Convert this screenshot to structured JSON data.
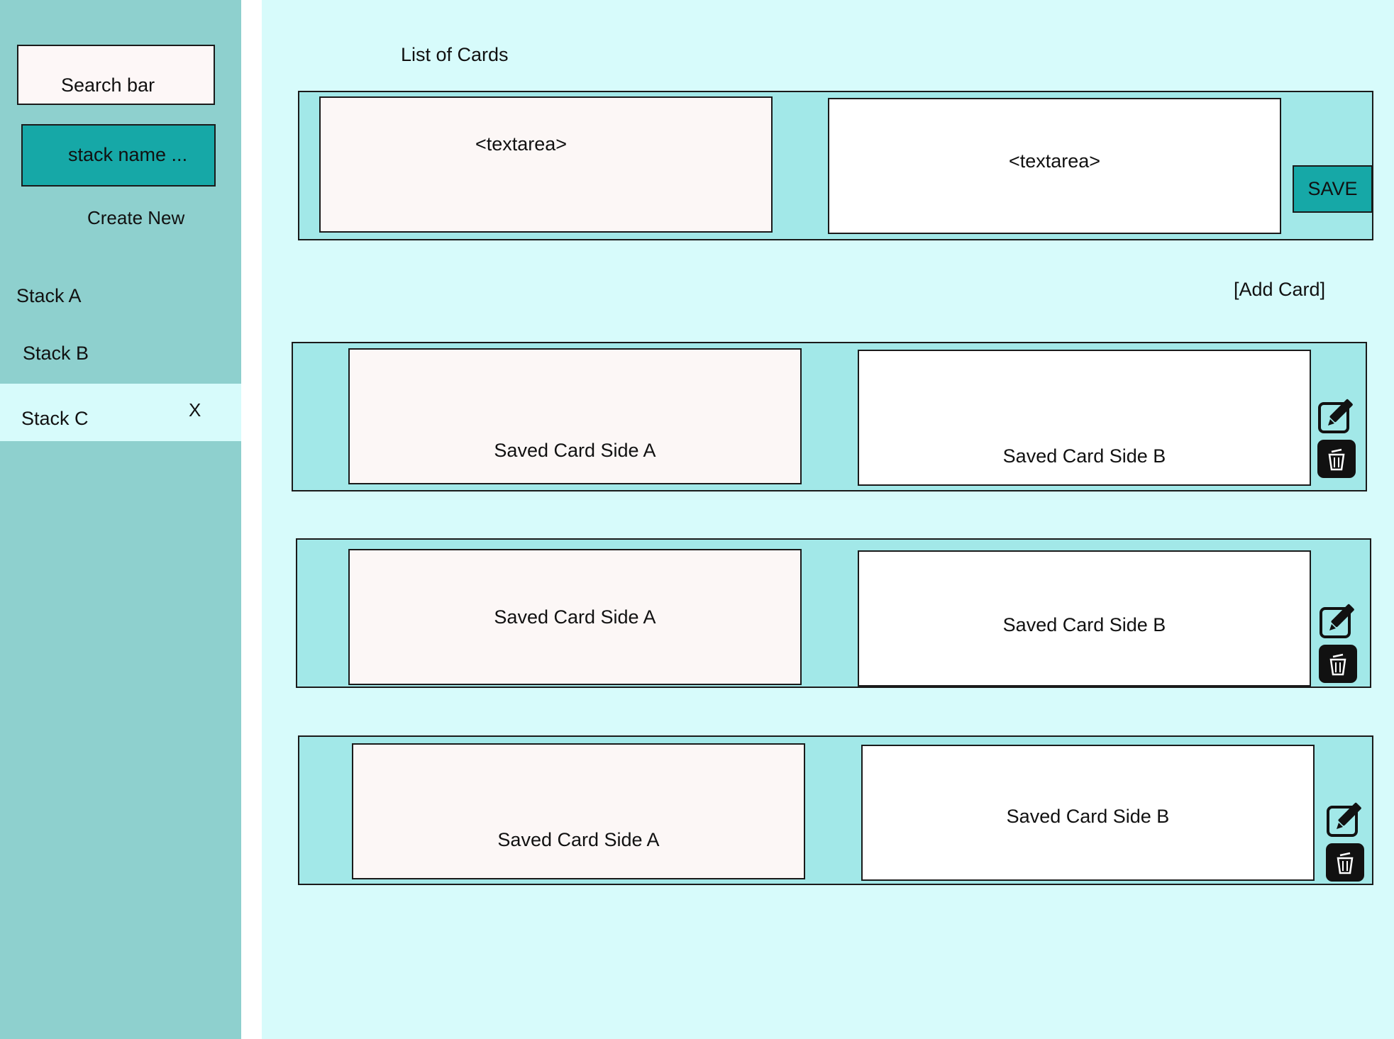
{
  "sidebar": {
    "search_label": "Search bar",
    "stack_name_label": "stack name ...",
    "create_new_label": "Create New",
    "stacks": [
      {
        "label": "Stack A"
      },
      {
        "label": "Stack B"
      },
      {
        "label": "Stack C",
        "close_label": "X",
        "selected": true
      }
    ]
  },
  "main": {
    "title": "List of Cards",
    "editor": {
      "side_a": "<textarea>",
      "side_b": "<textarea>",
      "save_label": "SAVE"
    },
    "add_card_label": "[Add Card]",
    "cards": [
      {
        "side_a": "Saved Card Side A",
        "side_b": "Saved Card Side B"
      },
      {
        "side_a": "Saved Card Side A",
        "side_b": "Saved Card Side B"
      },
      {
        "side_a": "Saved Card Side A",
        "side_b": "Saved Card Side B"
      }
    ]
  },
  "icons": {
    "edit": "edit-icon",
    "delete": "trash-icon"
  },
  "colors": {
    "sidebar_bg": "#8ed0ce",
    "main_bg": "#d7fbfb",
    "card_row_bg": "#a2e8e8",
    "accent": "#16a8a7"
  }
}
